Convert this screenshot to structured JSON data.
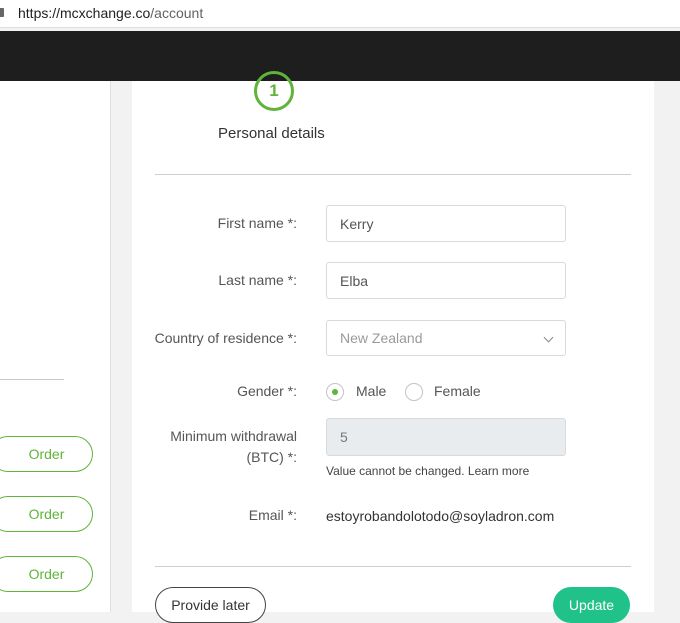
{
  "browser": {
    "url_host": "https://mcxchange.co",
    "url_path": "/account"
  },
  "sidebar": {
    "order_buttons": [
      "Order",
      "Order",
      "Order"
    ]
  },
  "step": {
    "number": "1",
    "title": "Personal details"
  },
  "form": {
    "first_name_label": "First name *:",
    "first_name_value": "Kerry",
    "last_name_label": "Last name *:",
    "last_name_value": "Elba",
    "country_label": "Country of residence *:",
    "country_value": "New Zealand",
    "gender_label": "Gender *:",
    "gender_male": "Male",
    "gender_female": "Female",
    "gender_selected": "Male",
    "min_withdrawal_label_line1": "Minimum withdrawal",
    "min_withdrawal_label_line2": "(BTC) *:",
    "min_withdrawal_value": "5",
    "min_withdrawal_hint": "Value cannot be changed. Learn more",
    "email_label": "Email *:",
    "email_value": "estoyrobandolotodo@soyladron.com"
  },
  "actions": {
    "provide_later": "Provide later",
    "update": "Update"
  },
  "colors": {
    "accent_green": "#5fb43a",
    "update_teal": "#21c18a"
  }
}
